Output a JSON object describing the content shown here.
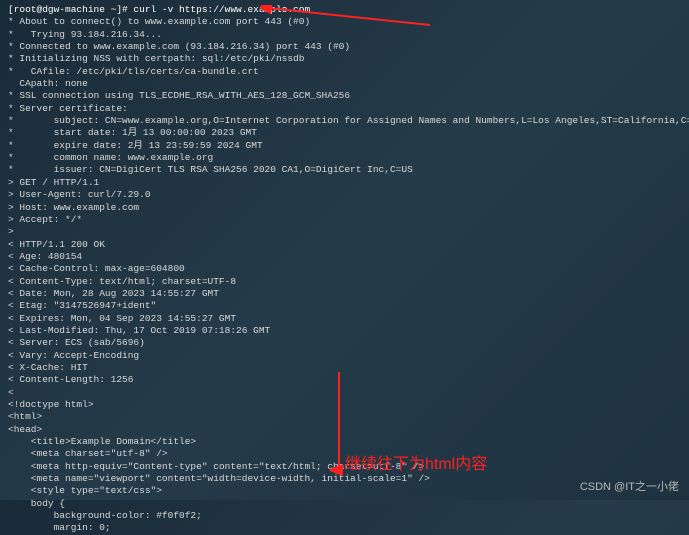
{
  "prompt": "[root@dgw-machine ~]# curl -v https://www.example.com",
  "lines": [
    "* About to connect() to www.example.com port 443 (#0)",
    "*   Trying 93.184.216.34...",
    "* Connected to www.example.com (93.184.216.34) port 443 (#0)",
    "* Initializing NSS with certpath: sql:/etc/pki/nssdb",
    "*   CAfile: /etc/pki/tls/certs/ca-bundle.crt",
    "  CApath: none",
    "* SSL connection using TLS_ECDHE_RSA_WITH_AES_128_GCM_SHA256",
    "* Server certificate:",
    "*       subject: CN=www.example.org,O=Internet Corporation for Assigned Names and Numbers,L=Los Angeles,ST=California,C=US",
    "*       start date: 1月 13 00:00:00 2023 GMT",
    "*       expire date: 2月 13 23:59:59 2024 GMT",
    "*       common name: www.example.org",
    "*       issuer: CN=DigiCert TLS RSA SHA256 2020 CA1,O=DigiCert Inc,C=US",
    "> GET / HTTP/1.1",
    "> User-Agent: curl/7.29.0",
    "> Host: www.example.com",
    "> Accept: */*",
    "> ",
    "< HTTP/1.1 200 OK",
    "< Age: 480154",
    "< Cache-Control: max-age=604800",
    "< Content-Type: text/html; charset=UTF-8",
    "< Date: Mon, 28 Aug 2023 14:55:27 GMT",
    "< Etag: \"3147526947+ident\"",
    "< Expires: Mon, 04 Sep 2023 14:55:27 GMT",
    "< Last-Modified: Thu, 17 Oct 2019 07:18:26 GMT",
    "< Server: ECS (sab/5696)",
    "< Vary: Accept-Encoding",
    "< X-Cache: HIT",
    "< Content-Length: 1256",
    "< ",
    "<!doctype html>",
    "<html>",
    "<head>",
    "    <title>Example Domain</title>",
    "",
    "    <meta charset=\"utf-8\" />",
    "    <meta http-equiv=\"Content-type\" content=\"text/html; charset=utf-8\" />",
    "    <meta name=\"viewport\" content=\"width=device-width, initial-scale=1\" />",
    "    <style type=\"text/css\">",
    "    body {",
    "        background-color: #f0f0f2;",
    "        margin: 0;"
  ],
  "annotations": {
    "bottom_label": "继续往下为html内容",
    "arrow_color": "#ff2020"
  },
  "watermark": "CSDN @IT之一小佬"
}
